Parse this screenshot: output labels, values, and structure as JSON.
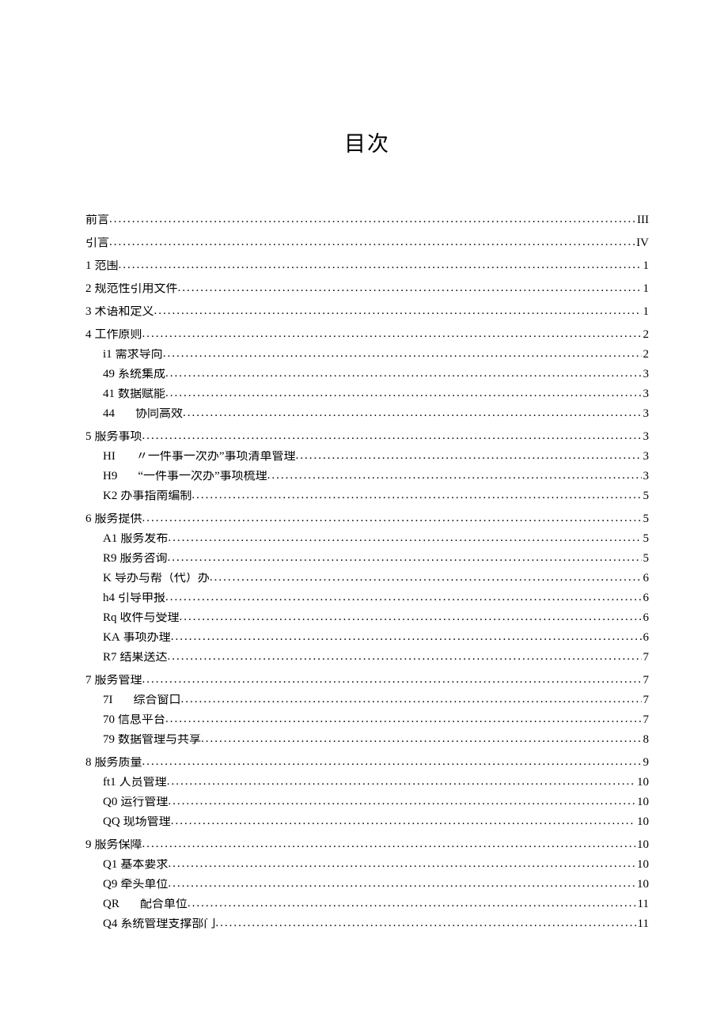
{
  "title": "目次",
  "entries": [
    {
      "level": 0,
      "num": "",
      "label": "前言",
      "page": "III",
      "gap": false
    },
    {
      "level": 0,
      "num": "",
      "label": "引言",
      "page": "IV",
      "gap": false
    },
    {
      "level": 0,
      "num": "1",
      "label": "范围",
      "page": "1",
      "gap": false
    },
    {
      "level": 0,
      "num": "2",
      "label": "规范性引用文件",
      "page": "1",
      "gap": false
    },
    {
      "level": 0,
      "num": "3",
      "label": "术语和定义",
      "page": "1",
      "gap": false
    },
    {
      "level": 0,
      "num": "4",
      "label": "工作原则",
      "page": "2",
      "gap": false
    },
    {
      "level": 1,
      "num": "i1",
      "label": "需求导向",
      "page": "2",
      "gap": false
    },
    {
      "level": 1,
      "num": "49",
      "label": "系统集成",
      "page": "3",
      "gap": false
    },
    {
      "level": 1,
      "num": "41",
      "label": "数据赋能",
      "page": "3",
      "gap": false
    },
    {
      "level": 1,
      "num": "44",
      "label": "协同高效",
      "page": "3",
      "gap": true
    },
    {
      "level": 0,
      "num": "5",
      "label": "服务事项",
      "page": "3",
      "gap": false
    },
    {
      "level": 1,
      "num": "HI",
      "label": "〃一件事一次办”事项清单管理",
      "page": "3",
      "gap": true
    },
    {
      "level": 1,
      "num": "H9",
      "label": "“一件事一次办”事项梳理",
      "page": "3",
      "gap": true
    },
    {
      "level": 1,
      "num": "K2",
      "label": "办事指南编制",
      "page": "5",
      "gap": false
    },
    {
      "level": 0,
      "num": "6",
      "label": "服务提供",
      "page": "5",
      "gap": false
    },
    {
      "level": 1,
      "num": "A1",
      "label": "服务发布",
      "page": "5",
      "gap": false
    },
    {
      "level": 1,
      "num": "R9",
      "label": "服务咨询",
      "page": "5",
      "gap": false
    },
    {
      "level": 1,
      "num": "K",
      "label": "导办与帮（代）办",
      "page": "6",
      "gap": false
    },
    {
      "level": 1,
      "num": "h4",
      "label": "引导申报",
      "page": "6",
      "gap": false
    },
    {
      "level": 1,
      "num": "Rq",
      "label": "收件与受理",
      "page": "6",
      "gap": false
    },
    {
      "level": 1,
      "num": "KA",
      "label": "事项办理",
      "page": "6",
      "gap": false
    },
    {
      "level": 1,
      "num": "R7",
      "label": "结果送达",
      "page": "7",
      "gap": false
    },
    {
      "level": 0,
      "num": "7",
      "label": "服务管理",
      "page": "7",
      "gap": false
    },
    {
      "level": 1,
      "num": "7I",
      "label": "综合窗口",
      "page": "7",
      "gap": true
    },
    {
      "level": 1,
      "num": "70",
      "label": "信息平台",
      "page": "7",
      "gap": false
    },
    {
      "level": 1,
      "num": "79",
      "label": "数据管理与共享",
      "page": "8",
      "gap": false
    },
    {
      "level": 0,
      "num": "8",
      "label": "服务质量",
      "page": "9",
      "gap": false
    },
    {
      "level": 1,
      "num": "ft1",
      "label": "人员管理",
      "page": "10",
      "gap": false
    },
    {
      "level": 1,
      "num": "Q0",
      "label": "运行管理",
      "page": "10",
      "gap": false
    },
    {
      "level": 1,
      "num": "QQ",
      "label": "现场管理",
      "page": "10",
      "gap": false
    },
    {
      "level": 0,
      "num": "9",
      "label": "服务保障",
      "page": "10",
      "gap": false
    },
    {
      "level": 1,
      "num": "Q1",
      "label": "基本要求",
      "page": "10",
      "gap": false
    },
    {
      "level": 1,
      "num": "Q9",
      "label": "牵头单位",
      "page": "10",
      "gap": false
    },
    {
      "level": 1,
      "num": "QR",
      "label": "配合单位",
      "page": "11",
      "gap": true
    },
    {
      "level": 1,
      "num": "Q4",
      "label": "系统管理支撑部门",
      "page": "11",
      "gap": false
    }
  ]
}
